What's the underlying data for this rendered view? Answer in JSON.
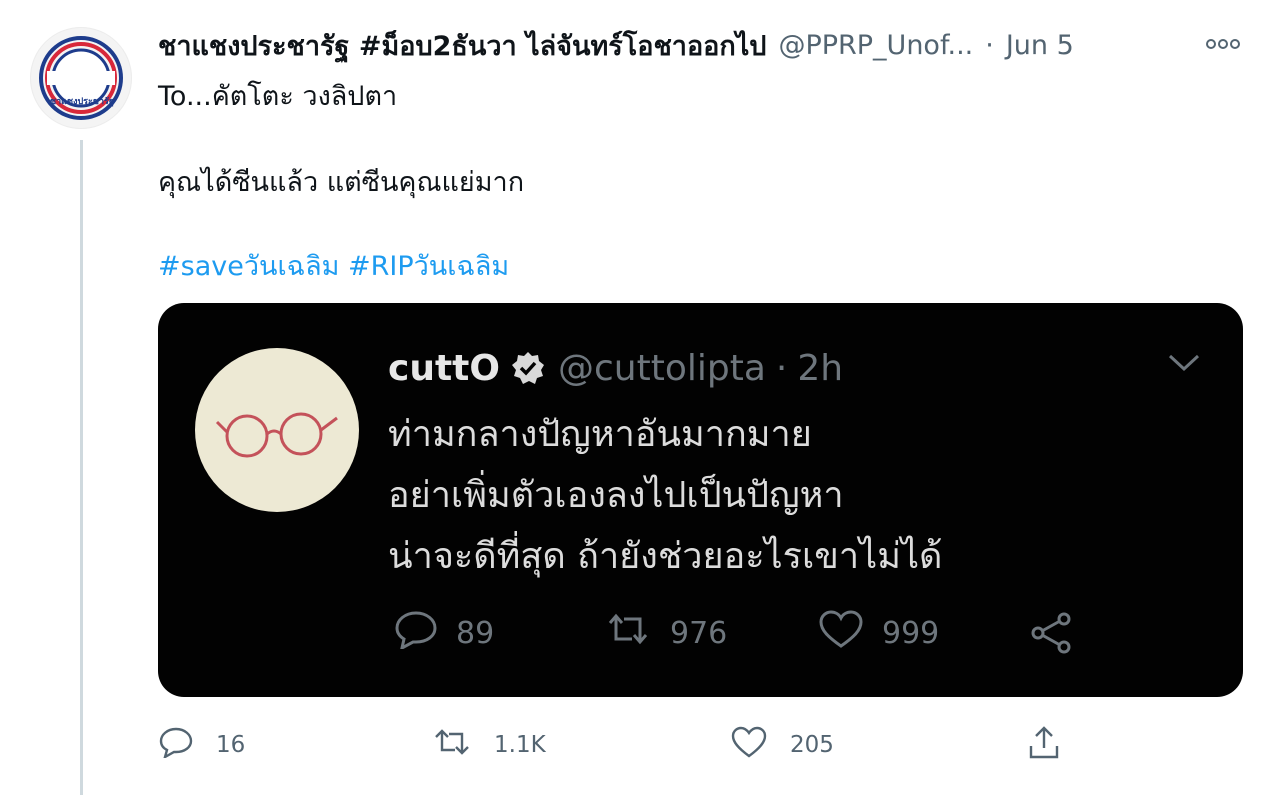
{
  "tweet": {
    "display_name": "ชาแชงประชารัฐ #ม็อบ2ธันวา ไล่จันทร์โอชาออกไป",
    "handle": "@PPRP_Unof...",
    "separator": "·",
    "time": "Jun 5",
    "avatar_text": "ชาแชงประชารัฐ",
    "lines": [
      "To...คัตโตะ วงลิปตา",
      "คุณได้ซีนแล้ว แต่ซีนคุณแย่มาก"
    ],
    "hashtags": [
      "#saveวันเฉลิม",
      "#RIPวันเฉลิม"
    ],
    "actions": {
      "reply_count": "16",
      "retweet_count": "1.1K",
      "like_count": "205"
    }
  },
  "embedded": {
    "name": "cuttO",
    "handle": "@cuttolipta",
    "separator": "·",
    "time": "2h",
    "lines": [
      "ท่ามกลางปัญหาอันมากมาย",
      "อย่าเพิ่มตัวเองลงไปเป็นปัญหา",
      "น่าจะดีที่สุด ถ้ายังช่วยอะไรเขาไม่ได้"
    ],
    "actions": {
      "reply_count": "89",
      "retweet_count": "976",
      "like_count": "999"
    }
  },
  "colors": {
    "hashtag": "#1d9bf0",
    "secondary_text": "#536471",
    "embed_background": "#020202"
  },
  "icons": [
    "more-icon",
    "reply-icon",
    "retweet-icon",
    "like-icon",
    "share-icon",
    "verified-icon",
    "chevron-down-icon"
  ]
}
